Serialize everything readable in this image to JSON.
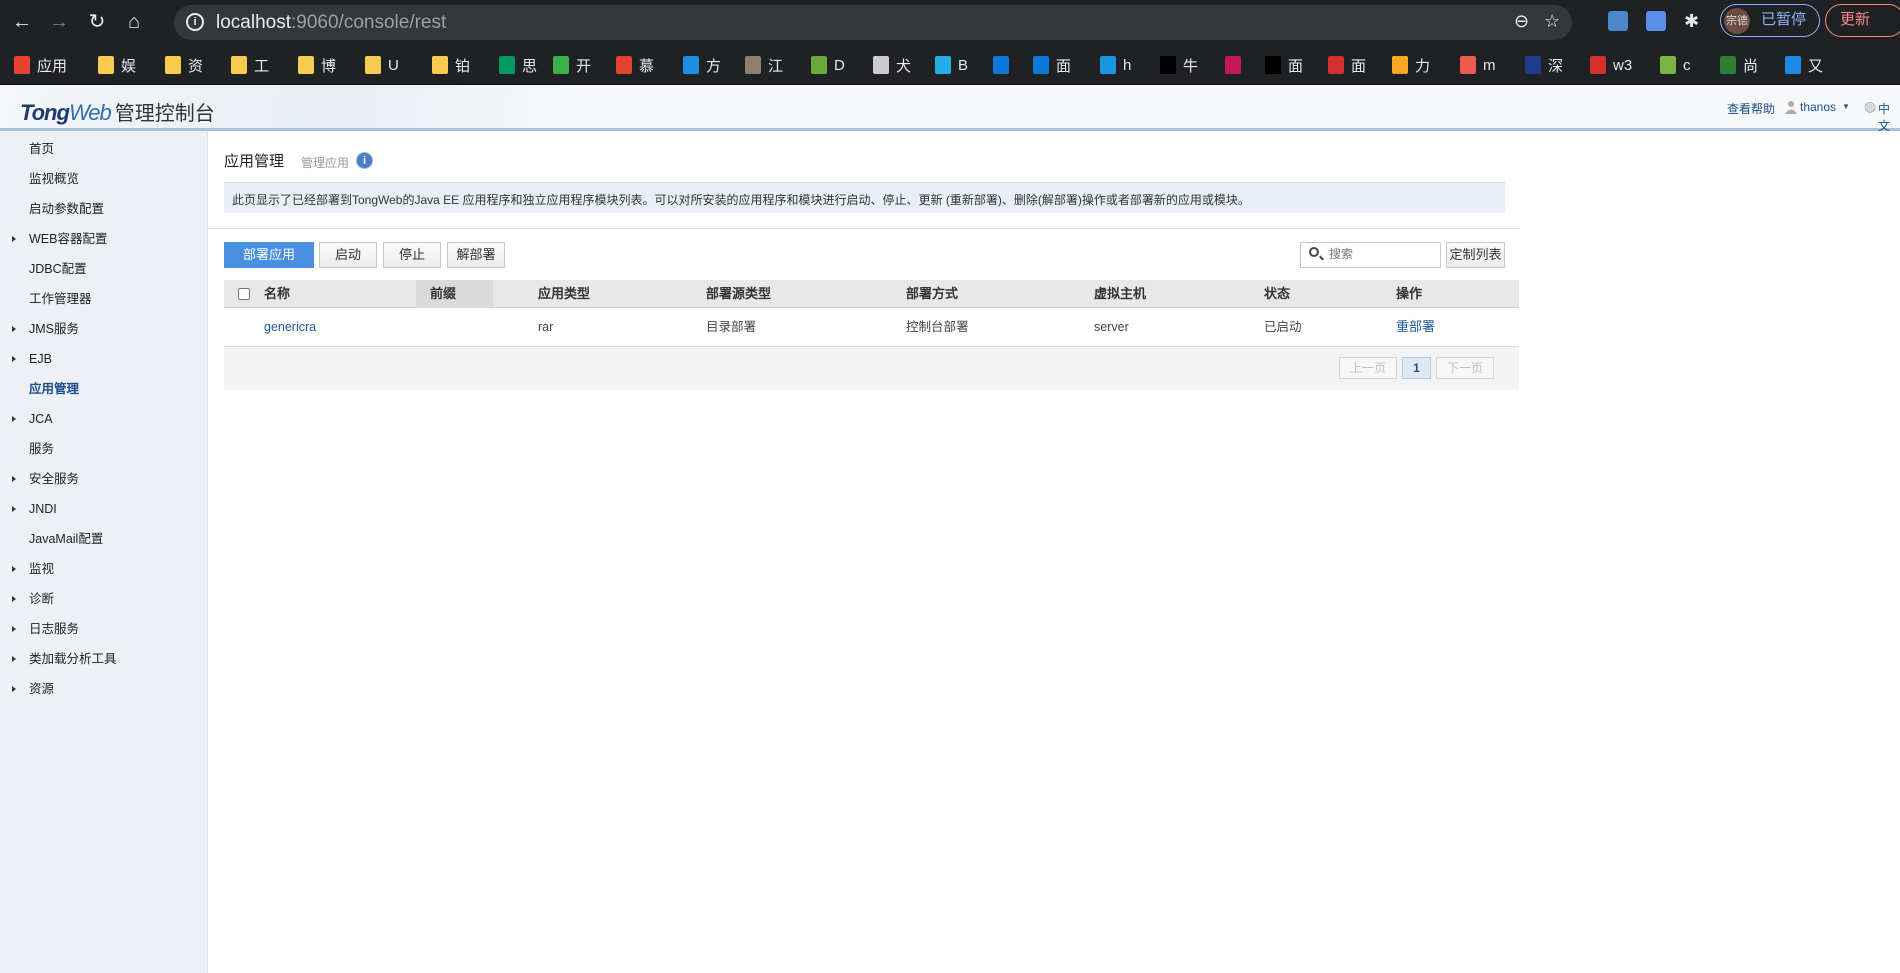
{
  "browser": {
    "url_host": "localhost",
    "url_path": ":9060/console/rest",
    "profile_name": "宗德",
    "paused_label": "已暂停",
    "update_label": "更新",
    "bookmarks": [
      {
        "label": "应用",
        "color": "#e94235"
      },
      {
        "label": "娱",
        "color": "#f7cb4d"
      },
      {
        "label": "资",
        "color": "#f7cb4d"
      },
      {
        "label": "工",
        "color": "#f7cb4d"
      },
      {
        "label": "博",
        "color": "#f7cb4d"
      },
      {
        "label": "U",
        "color": "#f7cb4d"
      },
      {
        "label": "铂",
        "color": "#f7cb4d"
      },
      {
        "label": "思",
        "color": "#009a61"
      },
      {
        "label": "开",
        "color": "#3dae49"
      },
      {
        "label": "慕",
        "color": "#e5412e"
      },
      {
        "label": "方",
        "color": "#1c8fe1"
      },
      {
        "label": "江",
        "color": "#8c7f6c"
      },
      {
        "label": "D",
        "color": "#6aaa3b"
      },
      {
        "label": "犬",
        "color": "#cccccc"
      },
      {
        "label": "B",
        "color": "#23ade5"
      },
      {
        "label": "",
        "color": "#0d78d8"
      },
      {
        "label": "面",
        "color": "#0d78d8"
      },
      {
        "label": "h",
        "color": "#1b95e0"
      },
      {
        "label": "牛",
        "color": "#000000"
      },
      {
        "label": "",
        "color": "#c2185b"
      },
      {
        "label": "面",
        "color": "#000000"
      },
      {
        "label": "面",
        "color": "#d32f2f"
      },
      {
        "label": "力",
        "color": "#f9a825"
      },
      {
        "label": "m",
        "color": "#ec5a4d"
      },
      {
        "label": "深",
        "color": "#1e3a8a"
      },
      {
        "label": "w3",
        "color": "#d32f2f"
      },
      {
        "label": "c",
        "color": "#7cb342"
      },
      {
        "label": "尚",
        "color": "#2e7d32"
      },
      {
        "label": "又",
        "color": "#1e88e5"
      }
    ]
  },
  "header": {
    "logo_tong": "Tong",
    "logo_web": "Web",
    "logo_suffix": "管理控制台",
    "help": "查看帮助",
    "user": "thanos",
    "language": "中文"
  },
  "sidebar": {
    "items": [
      {
        "label": "首页",
        "expandable": false
      },
      {
        "label": "监视概览",
        "expandable": false
      },
      {
        "label": "启动参数配置",
        "expandable": false
      },
      {
        "label": "WEB容器配置",
        "expandable": true
      },
      {
        "label": "JDBC配置",
        "expandable": false
      },
      {
        "label": "工作管理器",
        "expandable": false
      },
      {
        "label": "JMS服务",
        "expandable": true
      },
      {
        "label": "EJB",
        "expandable": true
      },
      {
        "label": "应用管理",
        "expandable": false,
        "active": true
      },
      {
        "label": "JCA",
        "expandable": true
      },
      {
        "label": "服务",
        "expandable": false
      },
      {
        "label": "安全服务",
        "expandable": true
      },
      {
        "label": "JNDI",
        "expandable": true
      },
      {
        "label": "JavaMail配置",
        "expandable": false
      },
      {
        "label": "监视",
        "expandable": true
      },
      {
        "label": "诊断",
        "expandable": true
      },
      {
        "label": "日志服务",
        "expandable": true
      },
      {
        "label": "类加载分析工具",
        "expandable": true
      },
      {
        "label": "资源",
        "expandable": true
      }
    ]
  },
  "main": {
    "title": "应用管理",
    "subtitle": "管理应用",
    "description": "此页显示了已经部署到TongWeb的Java EE 应用程序和独立应用程序模块列表。可以对所安装的应用程序和模块进行启动、停止、更新 (重新部署)、删除(解部署)操作或者部署新的应用或模块。",
    "toolbar": {
      "deploy": "部署应用",
      "start": "启动",
      "stop": "停止",
      "undeploy": "解部署",
      "search_placeholder": "搜索",
      "customize": "定制列表"
    },
    "table": {
      "columns": [
        "名称",
        "前缀",
        "应用类型",
        "部署源类型",
        "部署方式",
        "虚拟主机",
        "状态",
        "操作"
      ],
      "rows": [
        {
          "name": "genericra",
          "prefix": "",
          "type": "rar",
          "source_type": "目录部署",
          "deploy_mode": "控制台部署",
          "virtual_host": "server",
          "status": "已启动",
          "action": "重部署"
        }
      ]
    },
    "pagination": {
      "prev": "上一页",
      "current": "1",
      "next": "下一页"
    }
  }
}
